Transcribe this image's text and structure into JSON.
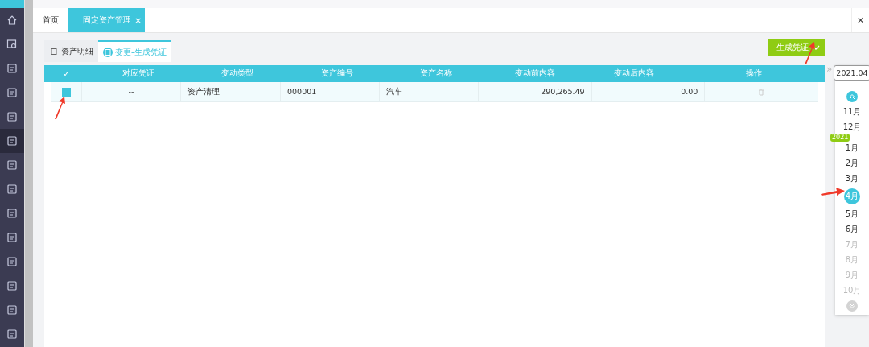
{
  "page_tabs": [
    {
      "label": "首页",
      "selected": false,
      "closable": false
    },
    {
      "label": "固定资产管理",
      "selected": true,
      "closable": true,
      "close": "×"
    }
  ],
  "close_all": "×",
  "sub_tabs": [
    {
      "label": "资产明细",
      "selected": false
    },
    {
      "label": "变更-生成凭证",
      "selected": true
    }
  ],
  "generate_button": "生成凭证",
  "table": {
    "columns": [
      "✓",
      "对应凭证",
      "变动类型",
      "资产编号",
      "资产名称",
      "变动前内容",
      "变动后内容",
      "操作"
    ],
    "rows": [
      {
        "checked": true,
        "voucher": "--",
        "change_type": "资产清理",
        "asset_no": "000001",
        "asset_name": "汽车",
        "before": "290,265.49",
        "after": "0.00"
      }
    ]
  },
  "expand": "»",
  "period": {
    "value": "2021.04",
    "year_badge": "2021",
    "months": [
      {
        "label": "11月",
        "selected": false,
        "disabled": false
      },
      {
        "label": "12月",
        "selected": false,
        "disabled": false
      },
      {
        "label": "1月",
        "selected": false,
        "disabled": false
      },
      {
        "label": "2月",
        "selected": false,
        "disabled": false
      },
      {
        "label": "3月",
        "selected": false,
        "disabled": false
      },
      {
        "label": "4月",
        "selected": true,
        "disabled": false
      },
      {
        "label": "5月",
        "selected": false,
        "disabled": false
      },
      {
        "label": "6月",
        "selected": false,
        "disabled": false
      },
      {
        "label": "7月",
        "selected": false,
        "disabled": true
      },
      {
        "label": "8月",
        "selected": false,
        "disabled": true
      },
      {
        "label": "9月",
        "selected": false,
        "disabled": true
      },
      {
        "label": "10月",
        "selected": false,
        "disabled": true
      }
    ]
  }
}
